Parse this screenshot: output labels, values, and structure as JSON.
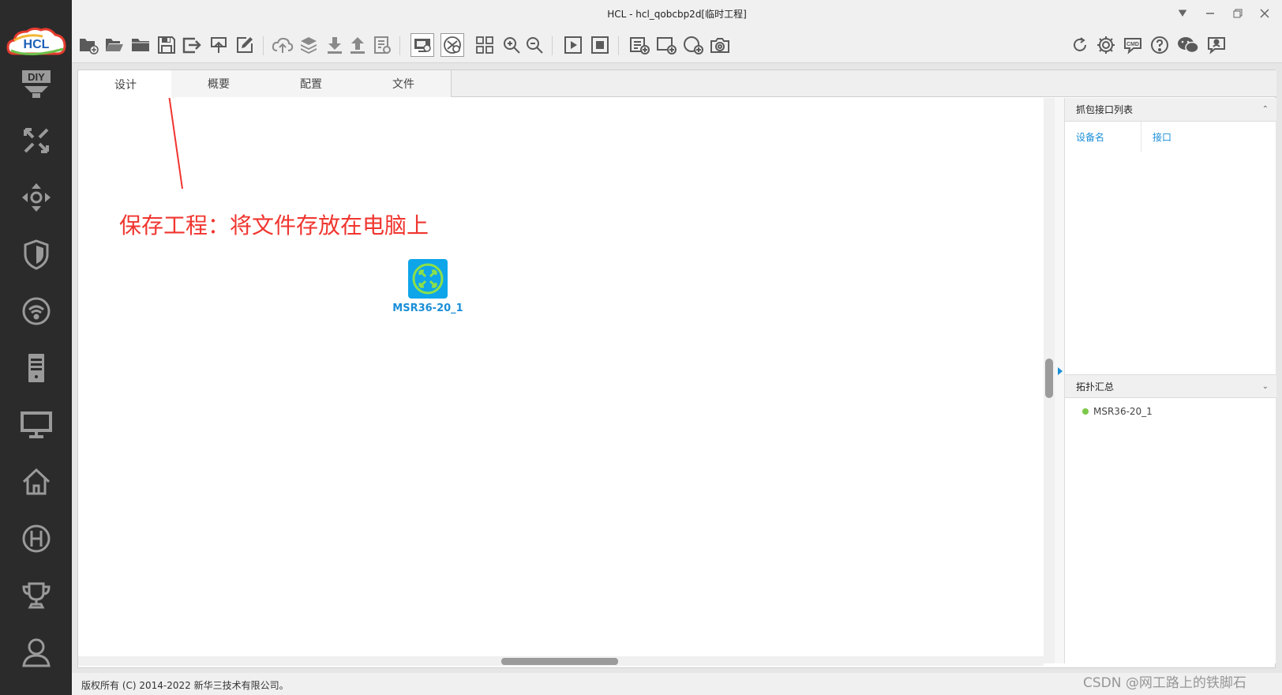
{
  "window": {
    "title": "HCL - hcl_qobcbp2d[临时工程]"
  },
  "sidebar": {
    "logo_text": "HCL",
    "items": [
      {
        "name": "diy-icon"
      },
      {
        "name": "router-icon"
      },
      {
        "name": "switch-icon"
      },
      {
        "name": "firewall-icon"
      },
      {
        "name": "wireless-icon"
      },
      {
        "name": "server-icon"
      },
      {
        "name": "terminal-icon"
      },
      {
        "name": "home-icon"
      },
      {
        "name": "h3c-icon"
      },
      {
        "name": "trophy-icon"
      },
      {
        "name": "user-icon"
      }
    ]
  },
  "tabs": [
    {
      "label": "设计"
    },
    {
      "label": "概要"
    },
    {
      "label": "配置"
    },
    {
      "label": "文件"
    }
  ],
  "canvas": {
    "annotation": "保存工程：将文件存放在电脑上",
    "device_label": "MSR36-20_1"
  },
  "right_panel": {
    "capture_header": "抓包接口列表",
    "col_device": "设备名",
    "col_interface": "接口",
    "topology_header": "拓扑汇总",
    "topology_items": [
      "MSR36-20_1"
    ]
  },
  "status": {
    "copyright": "版权所有 (C) 2014-2022 新华三技术有限公司。"
  },
  "watermark": "CSDN @网工路上的铁脚石",
  "colors": {
    "sidebar": "#2b2b2b",
    "accent": "#1a8fd8",
    "annotation": "#f0352f",
    "device": "#0ea5e9",
    "device_inner": "#8be04a",
    "status_dot": "#7cc84a"
  }
}
